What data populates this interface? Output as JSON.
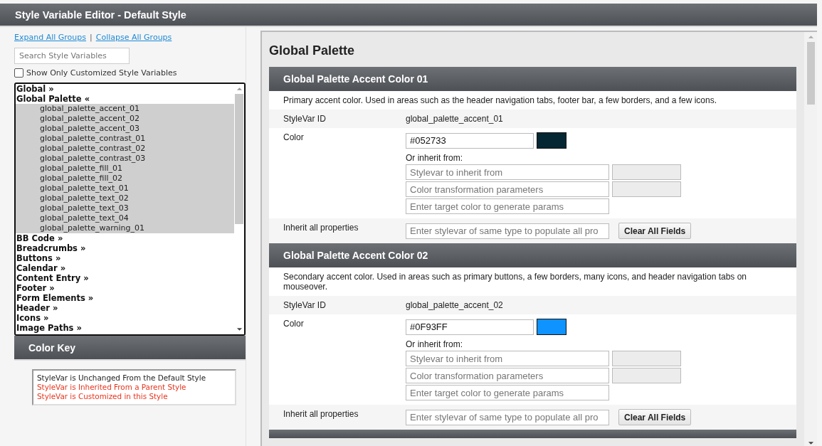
{
  "window": {
    "title": "Style Variable Editor - Default Style"
  },
  "sidebar": {
    "links": [
      "Expand All Groups",
      "Collapse All Groups"
    ],
    "separator": "|",
    "search": {
      "placeholder": "Search Style Variables"
    },
    "filter": {
      "label": "Show Only Customized Style Variables",
      "checked": false
    },
    "groups": [
      {
        "label": "Global »"
      },
      {
        "label": "Global Palette «",
        "children": [
          "global_palette_accent_01",
          "global_palette_accent_02",
          "global_palette_accent_03",
          "global_palette_contrast_01",
          "global_palette_contrast_02",
          "global_palette_contrast_03",
          "global_palette_fill_01",
          "global_palette_fill_02",
          "global_palette_text_01",
          "global_palette_text_02",
          "global_palette_text_03",
          "global_palette_text_04",
          "global_palette_warning_01"
        ]
      },
      {
        "label": "BB Code »"
      },
      {
        "label": "Breadcrumbs »"
      },
      {
        "label": "Buttons »"
      },
      {
        "label": "Calendar »"
      },
      {
        "label": "Content Entry »"
      },
      {
        "label": "Footer »"
      },
      {
        "label": "Form Elements »"
      },
      {
        "label": "Header »"
      },
      {
        "label": "Icons »"
      },
      {
        "label": "Image Paths »"
      }
    ],
    "color_key": {
      "title": "Color Key",
      "items": [
        {
          "text": "StyleVar is Unchanged From the Default Style",
          "color": "#222222"
        },
        {
          "text": "StyleVar is Inherited From a Parent Style",
          "color": "#e8341c"
        },
        {
          "text": "StyleVar is Customized in this Style",
          "color": "#e8341c"
        }
      ]
    }
  },
  "main": {
    "heading": "Global Palette",
    "sections": [
      {
        "title": "Global Palette Accent Color 01",
        "description": "Primary accent color. Used in areas such as the header navigation tabs, footer bar, a few borders, and a few icons.",
        "id_label": "StyleVar ID",
        "id": "global_palette_accent_01",
        "color_label": "Color",
        "color_value": "#052733",
        "inherit_label": "Or inherit from:",
        "inherit_placeholder": "Stylevar to inherit from",
        "transform_placeholder": "Color transformation parameters",
        "target_placeholder": "Enter target color to generate params",
        "all_label": "Inherit all properties",
        "all_placeholder": "Enter stylevar of same type to populate all pro",
        "clear_button": "Clear All Fields"
      },
      {
        "title": "Global Palette Accent Color 02",
        "description": "Secondary accent color. Used in areas such as primary buttons, a few borders, many icons, and header navigation tabs on mouseover.",
        "id_label": "StyleVar ID",
        "id": "global_palette_accent_02",
        "color_label": "Color",
        "color_value": "#0F93FF",
        "inherit_label": "Or inherit from:",
        "inherit_placeholder": "Stylevar to inherit from",
        "transform_placeholder": "Color transformation parameters",
        "target_placeholder": "Enter target color to generate params",
        "all_label": "Inherit all properties",
        "all_placeholder": "Enter stylevar of same type to populate all pro",
        "clear_button": "Clear All Fields"
      }
    ]
  }
}
